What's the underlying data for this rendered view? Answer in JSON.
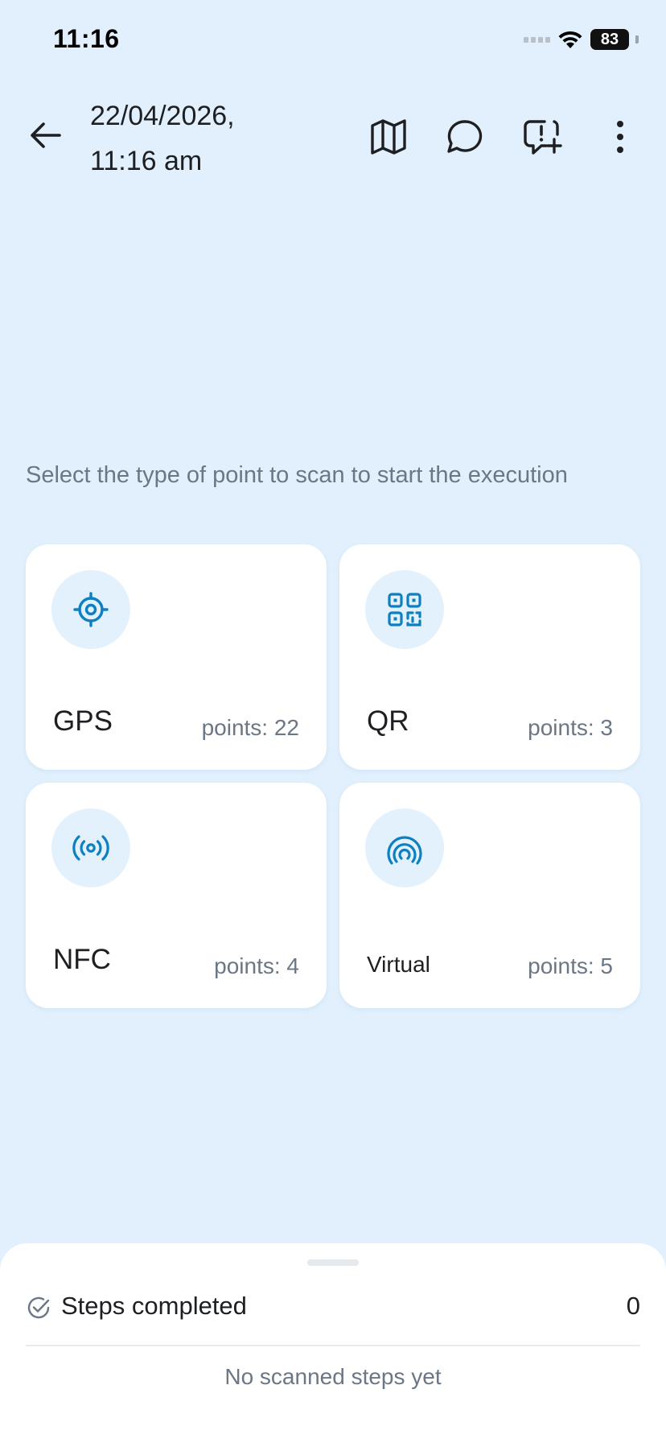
{
  "status_bar": {
    "time": "11:16",
    "battery": "83"
  },
  "header": {
    "date_line1": "22/04/2026,",
    "date_line2": "11:16 am"
  },
  "prompt": "Select the type of point to scan to start the execution",
  "point_types": [
    {
      "label": "GPS",
      "points": "points: 22",
      "icon": "gps-crosshair-icon"
    },
    {
      "label": "QR",
      "points": "points: 3",
      "icon": "qr-code-icon"
    },
    {
      "label": "NFC",
      "points": "points: 4",
      "icon": "nfc-signal-icon"
    },
    {
      "label": "Virtual",
      "points": "points: 5",
      "icon": "virtual-signal-icon"
    }
  ],
  "sheet": {
    "title": "Steps completed",
    "count": "0",
    "empty": "No scanned steps yet"
  },
  "colors": {
    "background": "#e1f0fc",
    "accent": "#0e7fc0",
    "icon_circle": "#e3f1fd",
    "card": "#ffffff"
  }
}
